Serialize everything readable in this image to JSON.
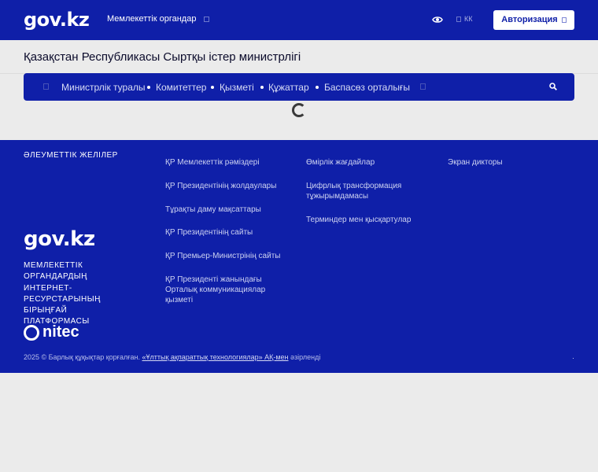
{
  "header": {
    "logo": "gov.kz",
    "gov_orgs_label": "Мемлекеттік органдар",
    "lang_label": "КК",
    "auth_label": "Авторизация"
  },
  "page": {
    "title": "Қазақстан Республикасы Сыртқы істер министрлігі"
  },
  "nav": {
    "items": [
      "Министрлік туралы",
      "Комитеттер",
      "Қызметі",
      "Құжаттар",
      "Баспасөз орталығы"
    ]
  },
  "footer": {
    "social_title": "ӘЛЕУМЕТТІК ЖЕЛІЛЕР",
    "logo": "gov.kz",
    "platform_text": "МЕМЛЕКЕТТІК ОРГАНДАРДЫҢ ИНТЕРНЕТ-РЕСУРСТАРЫНЫҢ БІРЫҢҒАЙ ПЛАТФОРМАСЫ",
    "nitec_label": "nitec",
    "col1": [
      "ҚР Мемлекеттік рәміздері",
      "ҚР Президентінің жолдаулары",
      "Тұрақты даму мақсаттары",
      "ҚР Президентінің сайты",
      "ҚР Премьер-Министрінің сайты",
      "ҚР Президенті жанындағы Орталық коммуникациялар қызметі"
    ],
    "col2": [
      "Өмірлік жағдайлар",
      "Цифрлық трансформация тұжырымдамасы",
      "Терминдер мен қысқартулар"
    ],
    "col3": [
      "Экран дикторы"
    ],
    "copyright_prefix": "2025 © Барлық құқықтар қорғалған.",
    "copyright_link": "«Ұлттық ақпараттық технологиялар» АҚ-мен",
    "copyright_suffix": "әзірленді"
  },
  "colors": {
    "brand_blue": "#0f1fa8",
    "background": "#ebebeb"
  }
}
